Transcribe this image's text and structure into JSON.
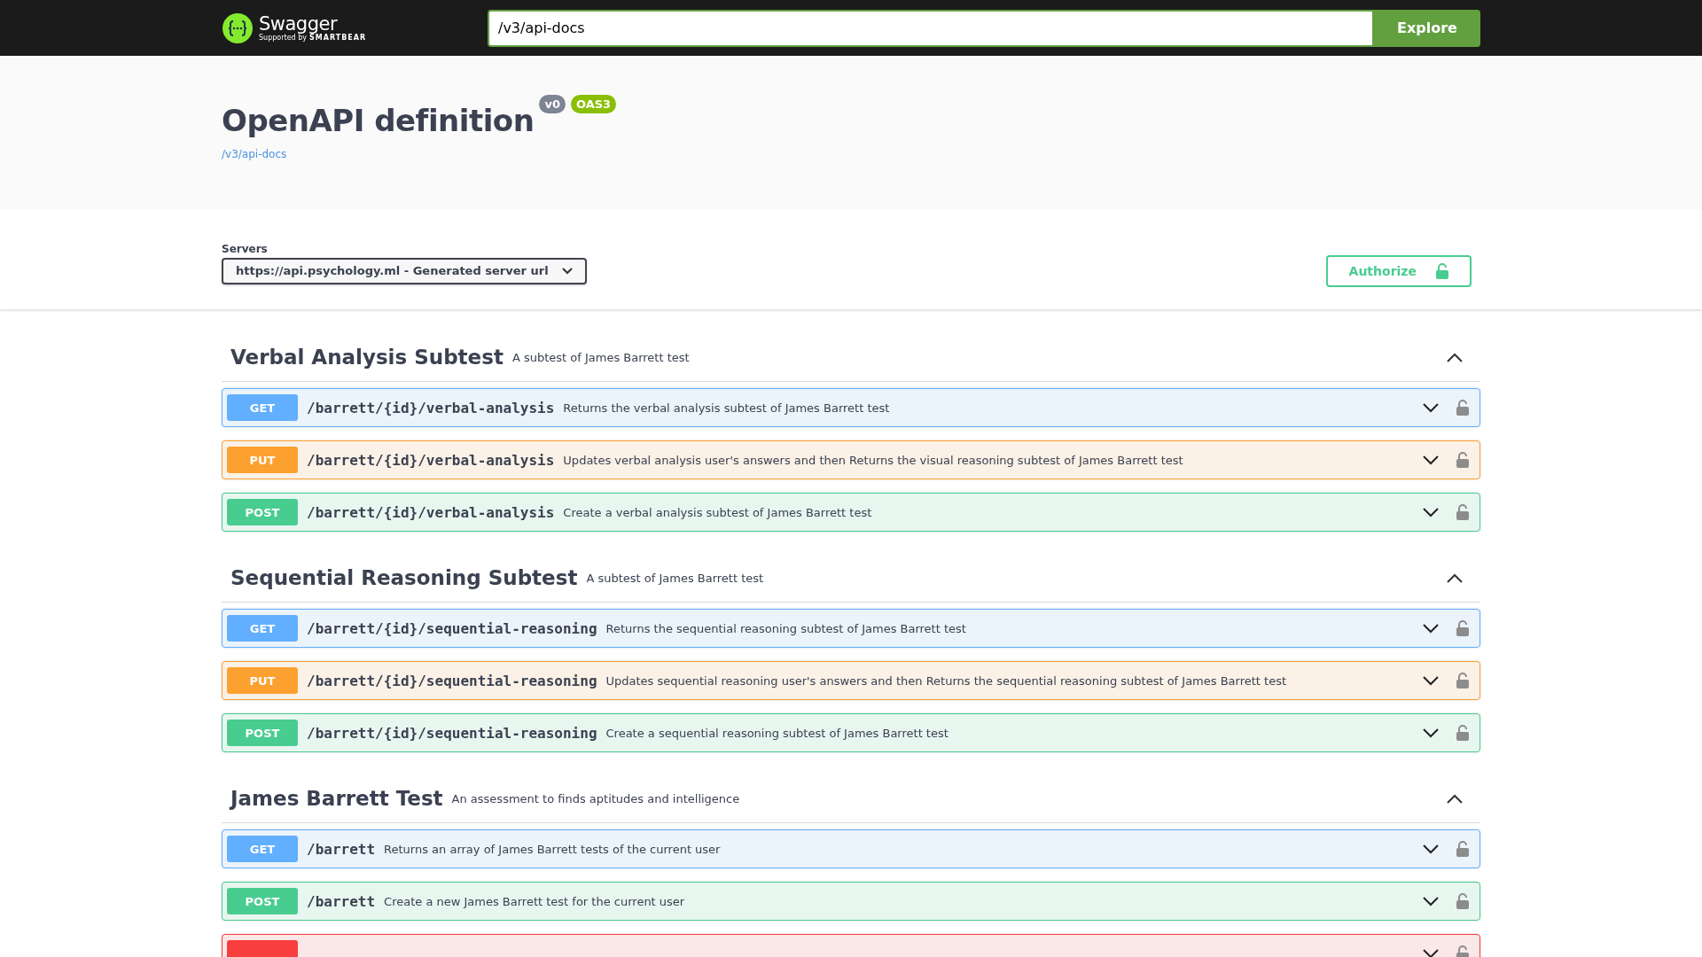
{
  "topbar": {
    "logo_text": "Swagger",
    "logo_subtext": "Supported by",
    "logo_brand": "SMARTBEAR",
    "url": "/v3/api-docs",
    "explore_button": "Explore"
  },
  "info": {
    "title": "OpenAPI definition",
    "version_badge": "v0",
    "spec_badge": "OAS3",
    "link": "/v3/api-docs"
  },
  "servers": {
    "label": "Servers",
    "selected": "https://api.psychology.ml - Generated server url",
    "authorize_button": "Authorize"
  },
  "tags": [
    {
      "name": "Verbal Analysis Subtest",
      "description": "A subtest of James Barrett test",
      "expanded": true,
      "operations": [
        {
          "kind": "get",
          "label": "GET",
          "path": "/barrett/{id}/verbal-analysis",
          "summary": "Returns the verbal analysis subtest of James Barrett test"
        },
        {
          "kind": "put",
          "label": "PUT",
          "path": "/barrett/{id}/verbal-analysis",
          "summary": "Updates verbal analysis user's answers and then Returns the visual reasoning subtest of James Barrett test"
        },
        {
          "kind": "post",
          "label": "POST",
          "path": "/barrett/{id}/verbal-analysis",
          "summary": "Create a verbal analysis subtest of James Barrett test"
        }
      ]
    },
    {
      "name": "Sequential Reasoning Subtest",
      "description": "A subtest of James Barrett test",
      "expanded": true,
      "operations": [
        {
          "kind": "get",
          "label": "GET",
          "path": "/barrett/{id}/sequential-reasoning",
          "summary": "Returns the sequential reasoning subtest of James Barrett test"
        },
        {
          "kind": "put",
          "label": "PUT",
          "path": "/barrett/{id}/sequential-reasoning",
          "summary": "Updates sequential reasoning user's answers and then Returns the sequential reasoning subtest of James Barrett test"
        },
        {
          "kind": "post",
          "label": "POST",
          "path": "/barrett/{id}/sequential-reasoning",
          "summary": "Create a sequential reasoning subtest of James Barrett test"
        }
      ]
    },
    {
      "name": "James Barrett Test",
      "description": "An assessment to finds aptitudes and intelligence",
      "expanded": true,
      "operations": [
        {
          "kind": "get",
          "label": "GET",
          "path": "/barrett",
          "summary": "Returns an array of James Barrett tests of the current user"
        },
        {
          "kind": "post",
          "label": "POST",
          "path": "/barrett",
          "summary": "Create a new James Barrett test for the current user"
        },
        {
          "kind": "delete"
        }
      ]
    }
  ]
}
